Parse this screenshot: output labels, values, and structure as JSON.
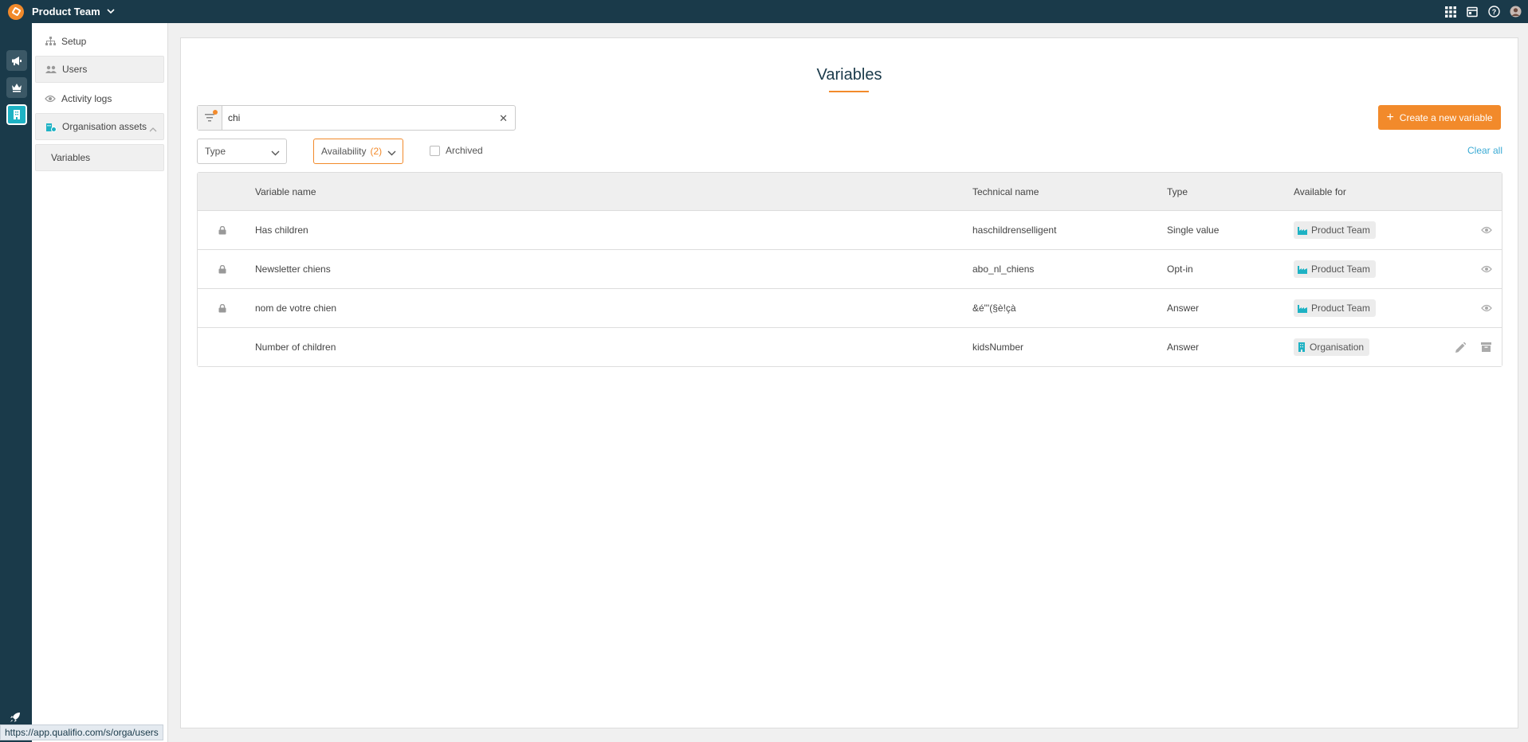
{
  "topbar": {
    "team_name": "Product Team",
    "icons": [
      "apps-grid-icon",
      "calendar-icon",
      "help-icon",
      "user-avatar-icon"
    ]
  },
  "rail": {
    "items": [
      "megaphone-icon",
      "crown-icon",
      "building-icon"
    ],
    "bottom_icon": "rocket-icon"
  },
  "sidebar": {
    "items": [
      {
        "label": "Setup",
        "icon": "hierarchy-icon"
      },
      {
        "label": "Users",
        "icon": "users-icon"
      },
      {
        "label": "Activity logs",
        "icon": "eye-icon"
      },
      {
        "label": "Organisation assets",
        "icon": "building-assets-icon"
      },
      {
        "label": "Variables"
      }
    ]
  },
  "main": {
    "title": "Variables",
    "search": {
      "value": "chi"
    },
    "create_button": "Create a new variable",
    "filters": {
      "type_label": "Type",
      "availability_label": "Availability",
      "availability_count": "(2)",
      "archived_label": "Archived",
      "clear_all": "Clear all"
    },
    "table": {
      "headers": {
        "name": "Variable name",
        "technical": "Technical name",
        "type": "Type",
        "available": "Available for"
      },
      "rows": [
        {
          "name": "Has children",
          "technical": "haschildrenselligent",
          "type": "Single value",
          "available": "Product Team",
          "locked": true
        },
        {
          "name": "Newsletter chiens",
          "technical": "abo_nl_chiens",
          "type": "Opt-in",
          "available": "Product Team",
          "locked": true
        },
        {
          "name": "nom de votre chien",
          "technical": "&é\"'(§è!çà",
          "type": "Answer",
          "available": "Product Team",
          "locked": true
        },
        {
          "name": "Number of children",
          "technical": "kidsNumber",
          "type": "Answer",
          "available": "Organisation",
          "locked": false
        }
      ]
    }
  },
  "status_bar": {
    "url": "https://app.qualifio.com/s/orga/users"
  },
  "colors": {
    "navy": "#1a3a4a",
    "accent": "#f28a2b",
    "teal": "#1eb2c4",
    "link": "#3aaad4"
  }
}
